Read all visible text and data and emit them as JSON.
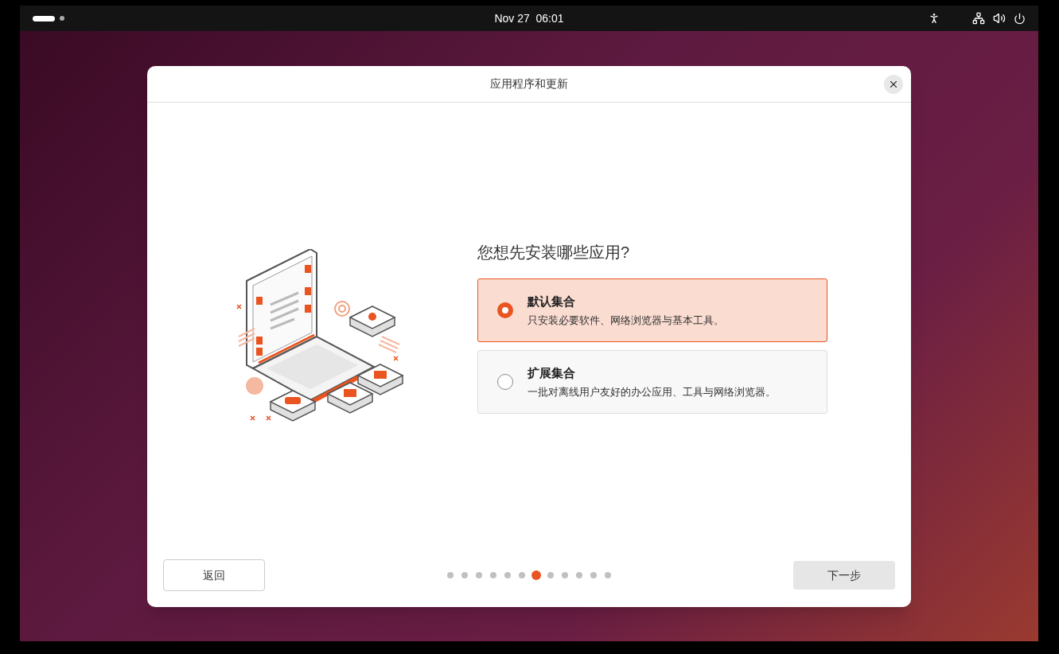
{
  "top_bar": {
    "clock": "Nov 27  06:01"
  },
  "dialog": {
    "title": "应用程序和更新",
    "question": "您想先安装哪些应用?",
    "options": [
      {
        "title": "默认集合",
        "description": "只安装必要软件、网络浏览器与基本工具。",
        "selected": true
      },
      {
        "title": "扩展集合",
        "description": "一批对离线用户友好的办公应用、工具与网络浏览器。",
        "selected": false
      }
    ],
    "back_button": "返回",
    "next_button": "下一步",
    "steps": [
      {
        "selected": false
      },
      {
        "selected": false
      },
      {
        "selected": false
      },
      {
        "selected": false
      },
      {
        "selected": false
      },
      {
        "selected": false
      },
      {
        "selected": true
      },
      {
        "selected": false
      },
      {
        "selected": false
      },
      {
        "selected": false
      },
      {
        "selected": false
      },
      {
        "selected": false
      }
    ]
  }
}
